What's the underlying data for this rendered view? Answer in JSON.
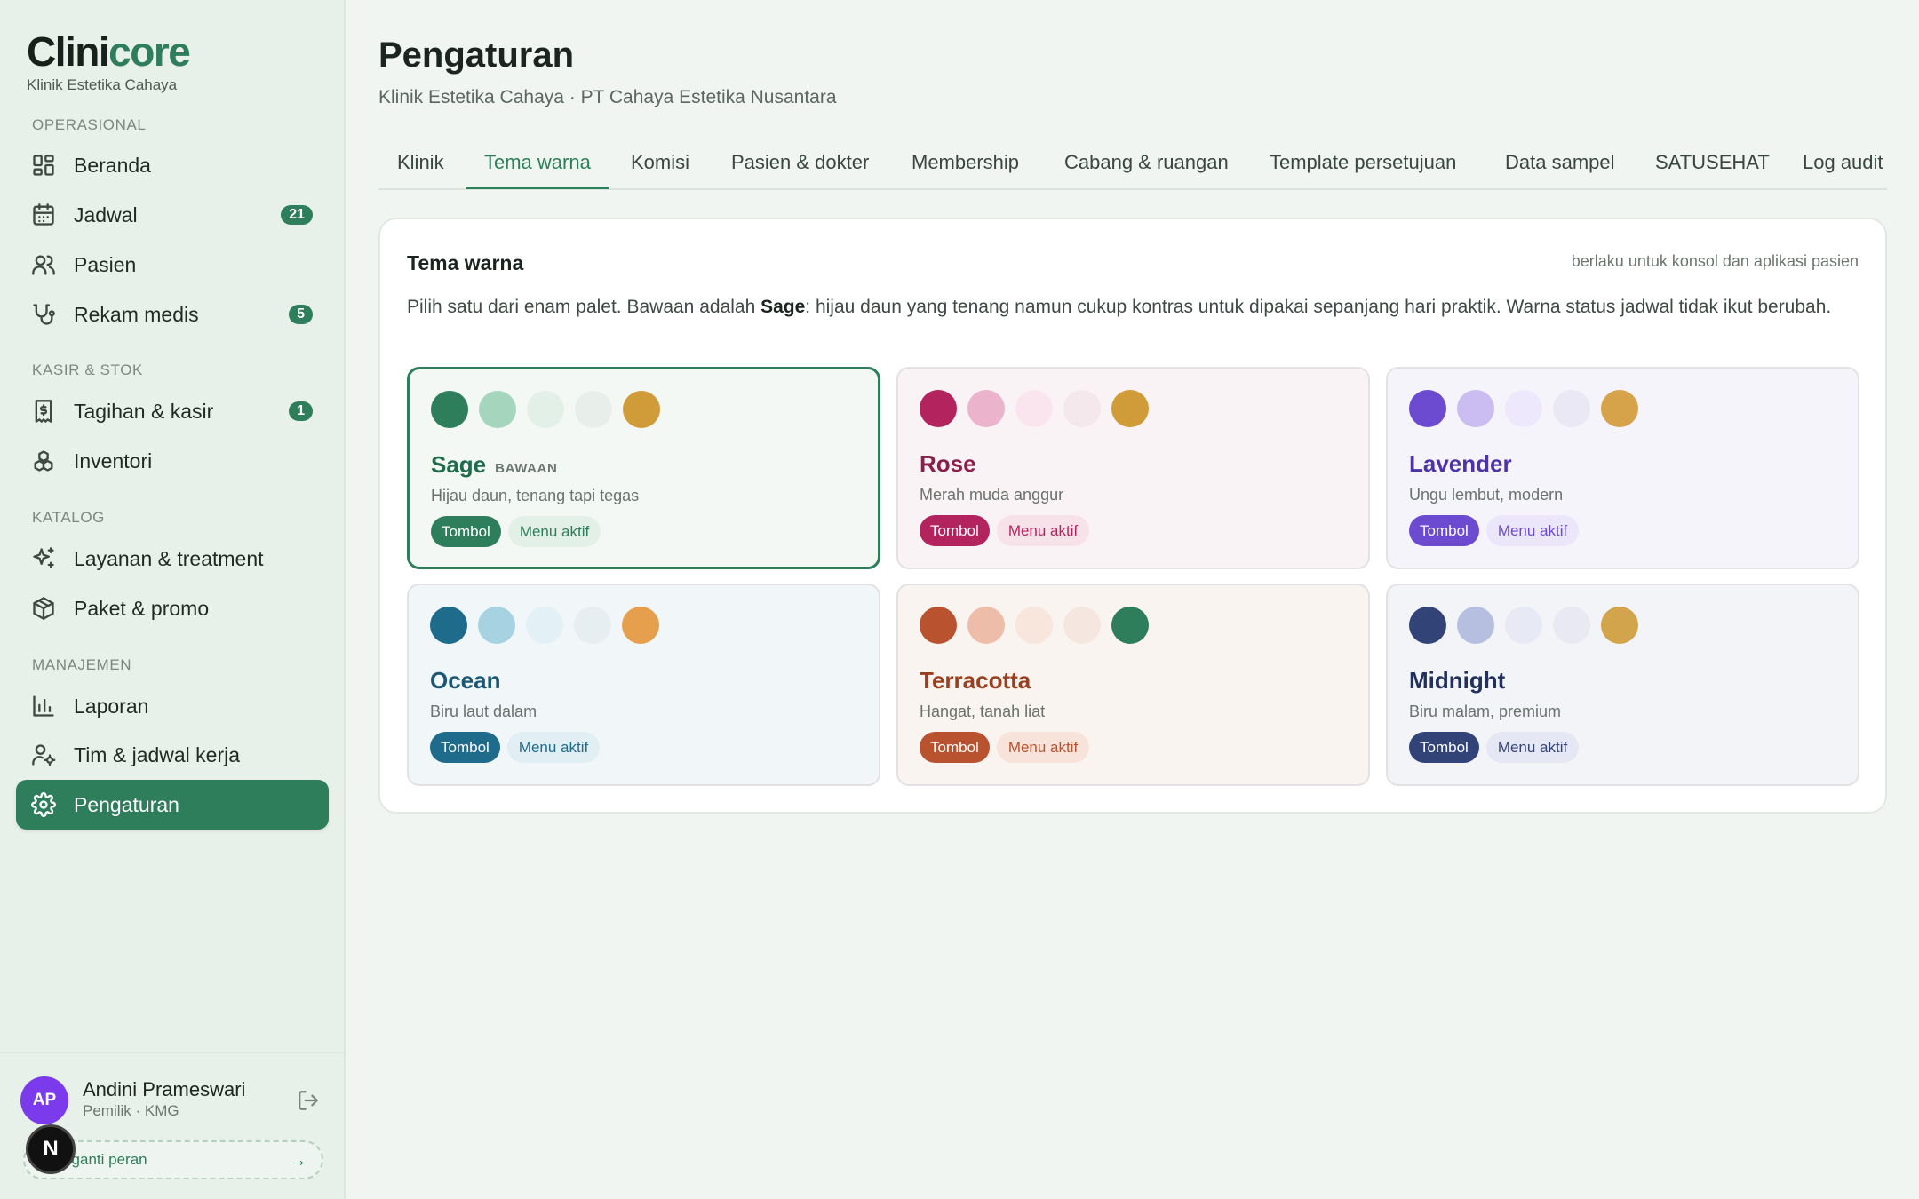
{
  "brand": {
    "logo_part1": "Clini",
    "logo_part2": "core",
    "clinic_name": "Klinik Estetika Cahaya"
  },
  "sidebar": {
    "sections": [
      {
        "label": "OPERASIONAL"
      },
      {
        "label": "KASIR & STOK"
      },
      {
        "label": "KATALOG"
      },
      {
        "label": "MANAJEMEN"
      }
    ],
    "items": [
      {
        "label": "Beranda",
        "icon": "dashboard-icon"
      },
      {
        "label": "Jadwal",
        "icon": "calendar-icon",
        "badge": "21"
      },
      {
        "label": "Pasien",
        "icon": "users-icon"
      },
      {
        "label": "Rekam medis",
        "icon": "stethoscope-icon",
        "badge": "5"
      },
      {
        "label": "Tagihan & kasir",
        "icon": "receipt-icon",
        "badge": "1"
      },
      {
        "label": "Inventori",
        "icon": "boxes-icon"
      },
      {
        "label": "Layanan & treatment",
        "icon": "sparkles-icon"
      },
      {
        "label": "Paket & promo",
        "icon": "package-icon"
      },
      {
        "label": "Laporan",
        "icon": "bar-chart-icon"
      },
      {
        "label": "Tim & jadwal kerja",
        "icon": "user-cog-icon"
      },
      {
        "label": "Pengaturan",
        "icon": "gear-icon",
        "active": true
      }
    ]
  },
  "user": {
    "initials": "AP",
    "name": "Andini Prameswari",
    "role": "Pemilik · KMG",
    "demo_label": "o · ganti peran",
    "demo_arrow": "→",
    "overlay_badge": "N"
  },
  "header": {
    "title": "Pengaturan",
    "subtitle": "Klinik Estetika Cahaya · PT Cahaya Estetika Nusantara"
  },
  "tabs": [
    {
      "label": "Klinik"
    },
    {
      "label": "Tema warna",
      "active": true
    },
    {
      "label": "Komisi"
    },
    {
      "label": "Pasien & dokter"
    },
    {
      "label": "Membership"
    },
    {
      "label": "Cabang & ruangan"
    },
    {
      "label": "Template persetujuan"
    },
    {
      "label": "Data sampel"
    },
    {
      "label": "SATUSEHAT"
    },
    {
      "label": "Log audit"
    }
  ],
  "theme_card": {
    "title": "Tema warna",
    "note": "berlaku untuk konsol dan aplikasi pasien",
    "desc_before": "Pilih satu dari enam palet. Bawaan adalah ",
    "desc_bold": "Sage",
    "desc_after": ": hijau daun yang tenang namun cukup kontras untuk dipakai sepanjang hari praktik. Warna status jadwal tidak ikut berubah.",
    "palettes": [
      {
        "name": "Sage",
        "tag": "BAWAAN",
        "desc": "Hijau daun, tenang tapi tegas",
        "button_label": "Tombol",
        "menu_label": "Menu aktif",
        "selected": true,
        "colors": [
          "#2e7d5b",
          "#a5d6bd",
          "#e3f0e8",
          "#e8efea",
          "#cf9c39"
        ],
        "name_color": "#1f6b4c",
        "bg": "#f4f8f5",
        "soft_bg": "#e3f0e8",
        "soft_text": "#2e7d5b"
      },
      {
        "name": "Rose",
        "desc": "Merah muda anggur",
        "button_label": "Tombol",
        "menu_label": "Menu aktif",
        "colors": [
          "#b3245f",
          "#ebb4cc",
          "#fae5ee",
          "#f5e8ed",
          "#cf9c39"
        ],
        "name_color": "#8c1e4b",
        "bg": "#faf3f5",
        "soft_bg": "#f8e2ea",
        "soft_text": "#b3245f"
      },
      {
        "name": "Lavender",
        "desc": "Ungu lembut, modern",
        "button_label": "Tombol",
        "menu_label": "Menu aktif",
        "colors": [
          "#6d4bd1",
          "#cbbcf1",
          "#ede8fb",
          "#ebe8f5",
          "#d6a24a"
        ],
        "name_color": "#4e33a8",
        "bg": "#f5f4fa",
        "soft_bg": "#ebe6f9",
        "soft_text": "#6d4bd1"
      },
      {
        "name": "Ocean",
        "desc": "Biru laut dalam",
        "button_label": "Tombol",
        "menu_label": "Menu aktif",
        "colors": [
          "#1f6b8c",
          "#a6d2e1",
          "#e3f0f5",
          "#e6eef1",
          "#e6a04d"
        ],
        "name_color": "#1c5873",
        "bg": "#f1f6f8",
        "soft_bg": "#e1eff5",
        "soft_text": "#1f6b8c"
      },
      {
        "name": "Terracotta",
        "desc": "Hangat, tanah liat",
        "button_label": "Tombol",
        "menu_label": "Menu aktif",
        "colors": [
          "#b8522f",
          "#eebda9",
          "#f8e5dc",
          "#f5e7e0",
          "#2e7d5b"
        ],
        "name_color": "#9a3f20",
        "bg": "#faf4f1",
        "soft_bg": "#f8e3da",
        "soft_text": "#b8522f"
      },
      {
        "name": "Midnight",
        "desc": "Biru malam, premium",
        "button_label": "Tombol",
        "menu_label": "Menu aktif",
        "colors": [
          "#324378",
          "#b6bfdf",
          "#e7e9f5",
          "#e8e9f2",
          "#d2a44c"
        ],
        "name_color": "#22305c",
        "bg": "#f3f4f8",
        "soft_bg": "#e5e8f4",
        "soft_text": "#324378"
      }
    ]
  }
}
